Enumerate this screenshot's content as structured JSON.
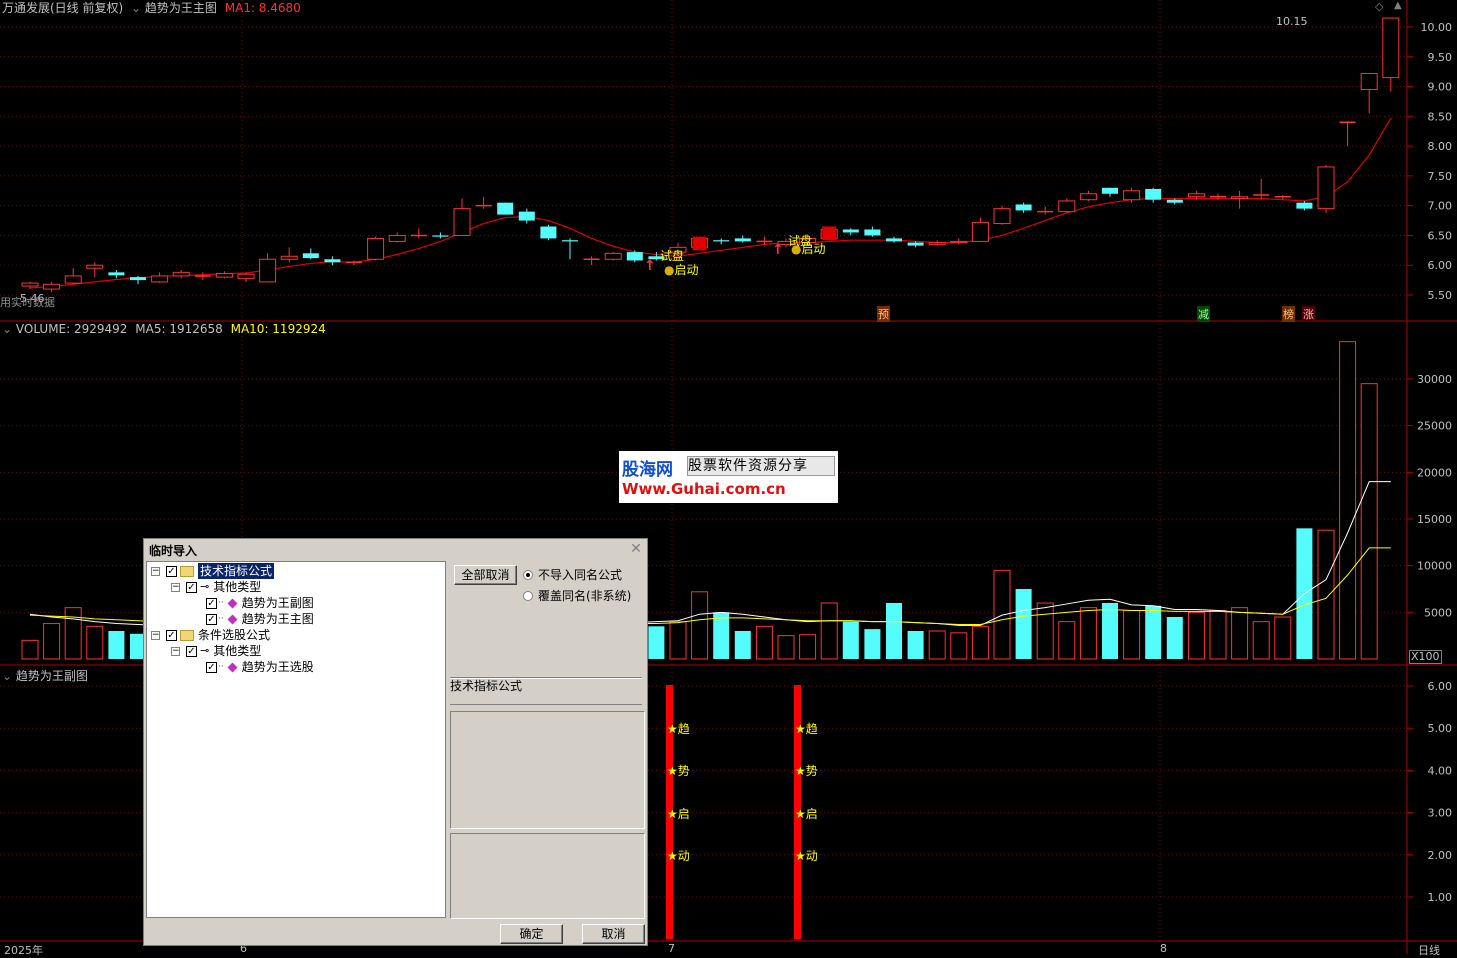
{
  "header": {
    "stock": "万通发展(日线 前复权)",
    "indicator": "趋势为王主图",
    "ma_label": "MA1: 8.4680",
    "price_high_label": "10.15",
    "price_low_label": "5.46",
    "notice": "用实时数据"
  },
  "markers": {
    "trial": "试盘",
    "start": "启动",
    "pre": "预",
    "reduce": "减",
    "board": "榜",
    "rise": "涨"
  },
  "volume_header": {
    "prefix": "VOLUME: 2929492",
    "ma5": "MA5: 1912658",
    "ma10": "MA10: 1192924",
    "scale": "X100"
  },
  "sub_header": {
    "title": "趋势为王副图",
    "chars": [
      "★趋",
      "★势",
      "★启",
      "★动"
    ]
  },
  "axes": {
    "price_ticks": [
      "10.00",
      "9.50",
      "9.00",
      "8.50",
      "8.00",
      "7.50",
      "7.00",
      "6.50",
      "6.00",
      "5.50"
    ],
    "volume_ticks": [
      "30000",
      "25000",
      "20000",
      "15000",
      "10000",
      "5000"
    ],
    "sub_ticks": [
      "6.00",
      "5.00",
      "4.00",
      "3.00",
      "2.00",
      "1.00"
    ],
    "date_labels": [
      "2025年",
      "6",
      "7",
      "8"
    ],
    "period": "日线"
  },
  "watermark": {
    "brand": "股海网",
    "slogan": "股票软件资源分享",
    "url": "Www.Guhai.com.cn"
  },
  "dialog": {
    "title": "临时导入",
    "tree": {
      "root1": "技术指标公式",
      "group1": "其他类型",
      "item1": "趋势为王副图",
      "item2": "趋势为王主图",
      "root2": "条件选股公式",
      "group2": "其他类型",
      "item3": "趋势为王选股"
    },
    "deselect_all": "全部取消",
    "radio_skip": "不导入同名公式",
    "radio_overwrite": "覆盖同名(非系统)",
    "category_label": "技术指标公式",
    "ok": "确定",
    "cancel": "取消"
  },
  "colors": {
    "up": "#ff3232",
    "down": "#54fcfc",
    "ma": "#e00000",
    "grid": "#600000",
    "axis_text": "#c0c0c0",
    "yellow": "#ffff00"
  },
  "chart_data": {
    "type": "candlestick",
    "price_range": [
      5.35,
      10.2
    ],
    "candles": [
      [
        5.65,
        5.7,
        5.72,
        5.6
      ],
      [
        5.6,
        5.68,
        5.72,
        5.55
      ],
      [
        5.7,
        5.82,
        5.95,
        5.68
      ],
      [
        5.95,
        6.0,
        6.05,
        5.8
      ],
      [
        5.88,
        5.83,
        5.92,
        5.78
      ],
      [
        5.8,
        5.75,
        5.82,
        5.68
      ],
      [
        5.72,
        5.82,
        5.88,
        5.7
      ],
      [
        5.82,
        5.88,
        5.92,
        5.78
      ],
      [
        5.82,
        5.82,
        5.88,
        5.75
      ],
      [
        5.8,
        5.86,
        5.9,
        5.78
      ],
      [
        5.78,
        5.85,
        5.88,
        5.72
      ],
      [
        5.72,
        6.1,
        6.2,
        5.72
      ],
      [
        6.1,
        6.15,
        6.3,
        6.05
      ],
      [
        6.2,
        6.12,
        6.28,
        6.1
      ],
      [
        6.1,
        6.05,
        6.15,
        6.0
      ],
      [
        6.05,
        6.05,
        6.08,
        6.0
      ],
      [
        6.1,
        6.45,
        6.48,
        6.08
      ],
      [
        6.4,
        6.5,
        6.55,
        6.38
      ],
      [
        6.5,
        6.5,
        6.62,
        6.45
      ],
      [
        6.5,
        6.48,
        6.55,
        6.45
      ],
      [
        6.5,
        6.95,
        7.12,
        6.5
      ],
      [
        7.0,
        7.0,
        7.15,
        6.95
      ],
      [
        7.05,
        6.85,
        7.05,
        6.85
      ],
      [
        6.9,
        6.75,
        6.95,
        6.7
      ],
      [
        6.65,
        6.45,
        6.68,
        6.42
      ],
      [
        6.42,
        6.4,
        6.45,
        6.1
      ],
      [
        6.1,
        6.1,
        6.15,
        6.0
      ],
      [
        6.1,
        6.2,
        6.22,
        6.08
      ],
      [
        6.22,
        6.08,
        6.25,
        6.05
      ],
      [
        6.15,
        6.1,
        6.22,
        6.08
      ],
      [
        6.22,
        6.3,
        6.38,
        6.18
      ],
      [
        6.3,
        6.45,
        6.48,
        6.25
      ],
      [
        6.42,
        6.4,
        6.45,
        6.35
      ],
      [
        6.45,
        6.4,
        6.5,
        6.38
      ],
      [
        6.4,
        6.4,
        6.48,
        6.35
      ],
      [
        6.35,
        6.4,
        6.45,
        6.3
      ],
      [
        6.38,
        6.45,
        6.52,
        6.35
      ],
      [
        6.45,
        6.6,
        6.65,
        6.42
      ],
      [
        6.6,
        6.55,
        6.62,
        6.5
      ],
      [
        6.6,
        6.5,
        6.65,
        6.48
      ],
      [
        6.45,
        6.4,
        6.48,
        6.38
      ],
      [
        6.38,
        6.33,
        6.4,
        6.3
      ],
      [
        6.35,
        6.38,
        6.42,
        6.33
      ],
      [
        6.38,
        6.4,
        6.45,
        6.35
      ],
      [
        6.4,
        6.72,
        6.8,
        6.4
      ],
      [
        6.7,
        6.95,
        7.0,
        6.68
      ],
      [
        7.02,
        6.92,
        7.05,
        6.88
      ],
      [
        6.9,
        6.9,
        6.98,
        6.85
      ],
      [
        6.9,
        7.08,
        7.12,
        6.88
      ],
      [
        7.1,
        7.2,
        7.25,
        7.08
      ],
      [
        7.3,
        7.2,
        7.3,
        7.15
      ],
      [
        7.1,
        7.25,
        7.3,
        7.05
      ],
      [
        7.28,
        7.1,
        7.3,
        7.05
      ],
      [
        7.1,
        7.05,
        7.12,
        7.02
      ],
      [
        7.15,
        7.2,
        7.25,
        7.1
      ],
      [
        7.15,
        7.15,
        7.2,
        7.1
      ],
      [
        7.12,
        7.15,
        7.25,
        6.95
      ],
      [
        7.18,
        7.18,
        7.45,
        7.1
      ],
      [
        7.15,
        7.15,
        7.18,
        7.1
      ],
      [
        7.05,
        6.95,
        7.08,
        6.92
      ],
      [
        6.95,
        7.65,
        7.68,
        6.88
      ],
      [
        8.4,
        8.4,
        8.42,
        8.0
      ],
      [
        8.95,
        9.22,
        9.22,
        8.55
      ],
      [
        9.15,
        10.15,
        10.15,
        8.92
      ]
    ],
    "ma_line": [
      5.62,
      5.64,
      5.68,
      5.72,
      5.76,
      5.79,
      5.81,
      5.83,
      5.84,
      5.86,
      5.87,
      5.92,
      5.98,
      6.03,
      6.06,
      6.05,
      6.1,
      6.18,
      6.28,
      6.4,
      6.55,
      6.7,
      6.8,
      6.82,
      6.75,
      6.62,
      6.45,
      6.32,
      6.22,
      6.18,
      6.15,
      6.2,
      6.25,
      6.3,
      6.35,
      6.38,
      6.38,
      6.4,
      6.42,
      6.42,
      6.42,
      6.4,
      6.38,
      6.38,
      6.42,
      6.5,
      6.62,
      6.75,
      6.88,
      6.98,
      7.05,
      7.1,
      7.12,
      7.12,
      7.12,
      7.12,
      7.12,
      7.12,
      7.1,
      7.08,
      7.15,
      7.4,
      7.85,
      8.47
    ],
    "volume_range": [
      0,
      34500
    ],
    "volumes": [
      2000,
      3800,
      5500,
      3500,
      3000,
      2700,
      3200,
      2800,
      2200,
      3500,
      3000,
      4500,
      4000,
      3500,
      3200,
      3000,
      5000,
      5200,
      4500,
      4000,
      4800,
      5000,
      4000,
      3500,
      3200,
      2800,
      3000,
      3800,
      4200,
      3500,
      4000,
      7200,
      5000,
      3000,
      3500,
      2500,
      2600,
      6000,
      4000,
      3200,
      6000,
      3000,
      3000,
      2800,
      3500,
      9500,
      7500,
      6000,
      4000,
      5500,
      6000,
      5200,
      5700,
      4500,
      5000,
      5200,
      5500,
      4000,
      4500,
      14000,
      13800,
      34000,
      29500,
      0
    ],
    "vol_ma5": [
      4800,
      4500,
      4300,
      4000,
      3800,
      3700,
      3600,
      3500,
      3500,
      3600,
      3700,
      3800,
      4000,
      4200,
      4300,
      4400,
      4500,
      4600,
      4600,
      4500,
      4500,
      4400,
      4200,
      4000,
      3800,
      3700,
      3700,
      3800,
      3900,
      4000,
      4100,
      4800,
      5000,
      4800,
      4500,
      4200,
      4000,
      4100,
      4100,
      4000,
      4000,
      3900,
      3800,
      3600,
      3600,
      4700,
      5200,
      5500,
      5900,
      6300,
      6400,
      5800,
      5700,
      5300,
      5300,
      5200,
      5000,
      4900,
      4800,
      7000,
      8500,
      13500,
      19000,
      19000
    ],
    "vol_ma10": [
      4700,
      4600,
      4500,
      4300,
      4200,
      4100,
      4000,
      3900,
      3800,
      3800,
      3800,
      3900,
      4000,
      4100,
      4200,
      4300,
      4400,
      4400,
      4400,
      4400,
      4400,
      4300,
      4200,
      4100,
      4000,
      3900,
      3800,
      3800,
      3800,
      3800,
      3900,
      4200,
      4400,
      4400,
      4300,
      4200,
      4100,
      4100,
      4100,
      4000,
      4000,
      3900,
      3800,
      3700,
      3700,
      4200,
      4600,
      4800,
      5000,
      5200,
      5300,
      5200,
      5200,
      5100,
      5100,
      5100,
      5000,
      4900,
      4800,
      5800,
      6500,
      9000,
      11900,
      11900
    ],
    "signal_bars": [
      31,
      37
    ],
    "sub_range": [
      0.5,
      6.25
    ]
  }
}
